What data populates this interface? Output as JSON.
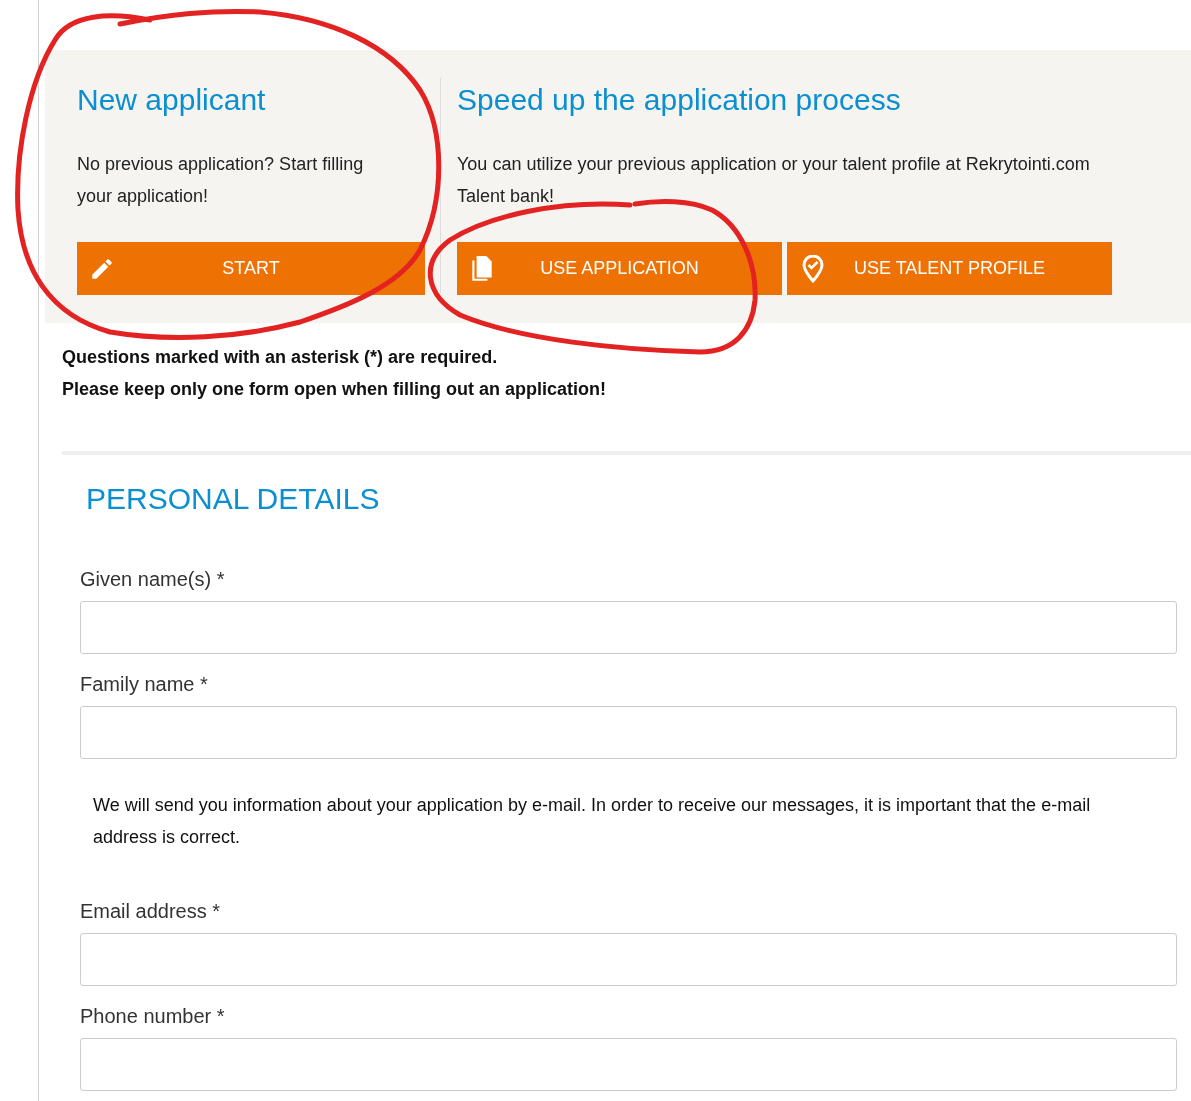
{
  "new_applicant": {
    "title": "New applicant",
    "text": "No previous application? Start filling your application!",
    "button": "START"
  },
  "speed_up": {
    "title": "Speed up the application process",
    "text": "You can utilize your previous application or your talent profile at Rekrytointi.com Talent bank!",
    "buttons": [
      {
        "label": "USE APPLICATION",
        "kind": "copy"
      },
      {
        "label": "USE TALENT PROFILE",
        "kind": "pin"
      }
    ]
  },
  "notices": [
    "Questions marked with an asterisk (*) are required.",
    "Please keep only one form open when filling out an application!"
  ],
  "form": {
    "heading": "PERSONAL DETAILS",
    "items": [
      {
        "kind": "field",
        "label": "Given name(s) *"
      },
      {
        "kind": "field",
        "label": "Family name *"
      },
      {
        "kind": "note",
        "text": "We will send you information about your application by e-mail. In order to receive our messages, it is important that the e-mail address is correct."
      },
      {
        "kind": "field",
        "label": "Email address *"
      },
      {
        "kind": "field",
        "label": "Phone number *"
      }
    ]
  },
  "annotations": [
    {
      "kind": "loop"
    },
    {
      "kind": "loop"
    }
  ]
}
